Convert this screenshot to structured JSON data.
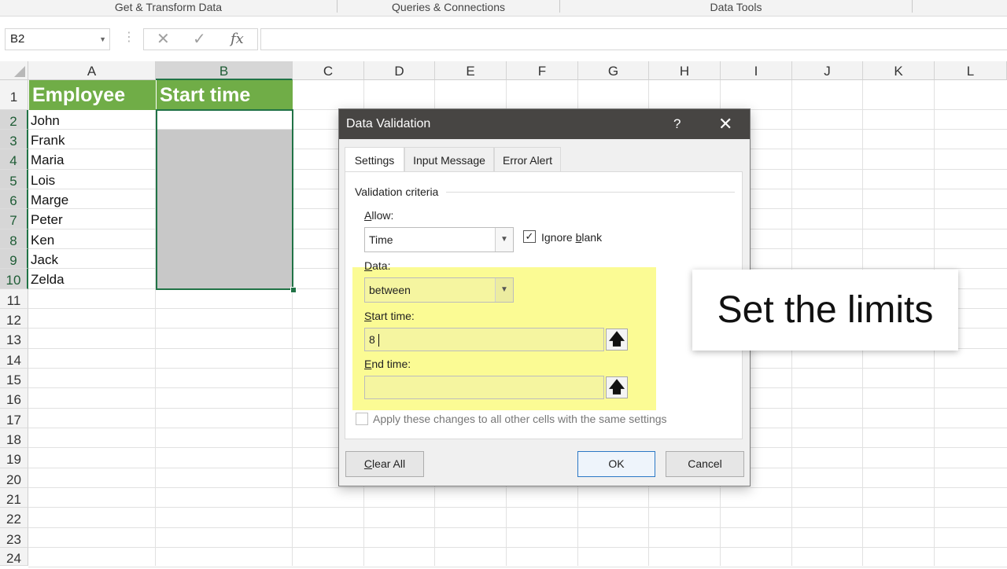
{
  "ribbon": {
    "groups": [
      "Get & Transform Data",
      "Queries & Connections",
      "Data Tools"
    ]
  },
  "formula_bar": {
    "name_box": "B2",
    "cancel_icon": "✕",
    "enter_icon": "✓",
    "fx_label": "fx",
    "formula": ""
  },
  "sheet": {
    "columns": [
      "A",
      "B",
      "C",
      "D",
      "E",
      "F",
      "G",
      "H",
      "I",
      "J",
      "K",
      "L"
    ],
    "rows": [
      "1",
      "2",
      "3",
      "4",
      "5",
      "6",
      "7",
      "8",
      "9",
      "10",
      "11",
      "12",
      "13",
      "14",
      "15",
      "16",
      "17",
      "18",
      "19",
      "20",
      "21",
      "22",
      "23",
      "24"
    ],
    "header": {
      "a1": "Employee",
      "b1": "Start time"
    },
    "employees": [
      "John",
      "Frank",
      "Maria",
      "Lois",
      "Marge",
      "Peter",
      "Ken",
      "Jack",
      "Zelda"
    ],
    "selected_column": "B",
    "header_fill": "#70ad47"
  },
  "dialog": {
    "title": "Data Validation",
    "help": "?",
    "close": "✕",
    "tabs": [
      "Settings",
      "Input Message",
      "Error Alert"
    ],
    "active_tab": "Settings",
    "group_label": "Validation criteria",
    "allow_label_u": "A",
    "allow_label_rest": "llow:",
    "allow_value": "Time",
    "ignore_blank_pre": "Ignore ",
    "ignore_blank_u": "b",
    "ignore_blank_post": "lank",
    "ignore_blank_checked": true,
    "data_label_u": "D",
    "data_label_rest": "ata:",
    "data_value": "between",
    "start_label_u": "S",
    "start_label_rest": "tart time:",
    "start_value": "8",
    "end_label_u": "E",
    "end_label_rest": "nd time:",
    "end_value": "",
    "apply_label": "Apply these changes to all other cells with the same settings",
    "clear_all_u": "C",
    "clear_all_rest": "lear All",
    "ok": "OK",
    "cancel": "Cancel",
    "highlight_color": "#f7f73c"
  },
  "callout": {
    "text": "Set the limits"
  }
}
